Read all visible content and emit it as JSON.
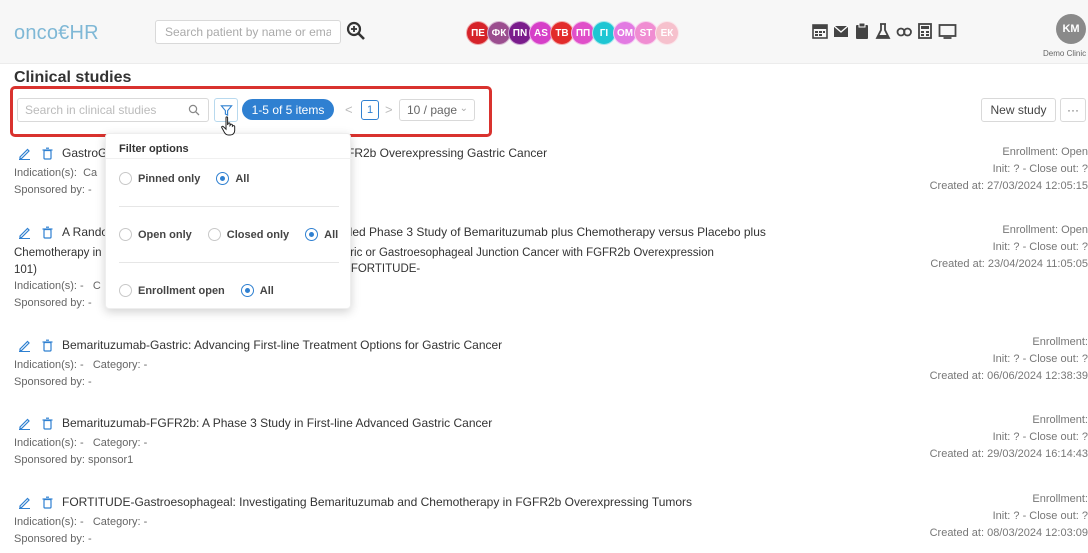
{
  "header": {
    "logo": "onco€HR",
    "search_placeholder": "Search patient by name or email",
    "avatars": [
      {
        "initials": "ПЕ",
        "color": "#d6232a"
      },
      {
        "initials": "ФК",
        "color": "#9b4e8f"
      },
      {
        "initials": "ПN",
        "color": "#7a1c8c"
      },
      {
        "initials": "AS",
        "color": "#d63fc8"
      },
      {
        "initials": "ТВ",
        "color": "#e22b2b"
      },
      {
        "initials": "ПП",
        "color": "#e04fc9"
      },
      {
        "initials": "ГІ",
        "color": "#1fc6d3"
      },
      {
        "initials": "ОМ",
        "color": "#e27ae2"
      },
      {
        "initials": "ST",
        "color": "#f08dd2"
      },
      {
        "initials": "ЕК",
        "color": "#f6c1cd"
      }
    ],
    "tool_icons": [
      "calendar-icon",
      "mail-icon",
      "clipboard-icon",
      "flask-icon",
      "microscope-icon",
      "calculator-icon",
      "monitor-icon"
    ],
    "user_initials": "KM",
    "user_org": "Demo Clinic"
  },
  "page": {
    "title": "Clinical studies",
    "search_placeholder": "Search in clinical studies",
    "items_label": "1-5 of 5 items",
    "current_page": "1",
    "page_size": "10 / page",
    "new_study_label": "New study",
    "more_label": "···",
    "accent_color": "#2f80d1",
    "highlight_color": "#d9322e"
  },
  "filter": {
    "title": "Filter options",
    "groups": [
      {
        "options": [
          {
            "label": "Pinned only",
            "selected": false
          },
          {
            "label": "All",
            "selected": true
          }
        ]
      },
      {
        "options": [
          {
            "label": "Open only",
            "selected": false
          },
          {
            "label": "Closed only",
            "selected": false
          },
          {
            "label": "All",
            "selected": true
          }
        ]
      },
      {
        "options": [
          {
            "label": "Enrollment open",
            "selected": false
          },
          {
            "label": "All",
            "selected": true
          }
        ]
      }
    ]
  },
  "studies": [
    {
      "title_visible": "GastroG",
      "title_tail": "FR2b Overexpressing Gastric Cancer",
      "indication": "Indication(s):",
      "indication_tail": "Ca",
      "sponsor": "Sponsored by: -",
      "enrollment": "Enrollment: Open",
      "init_close": "Init: ? - Close out: ?",
      "created": "Created at: 27/03/2024 12:05:15"
    },
    {
      "title_visible": "A Rando",
      "title_tail": "lled Phase 3 Study of Bemarituzumab plus Chemotherapy versus Placebo plus",
      "line2_head": "Chemotherapy in S",
      "line2_tail": "tric or Gastroesophageal Junction Cancer with FGFR2b Overexpression (FORTITUDE-",
      "line3": "101)",
      "indication": "Indication(s): -",
      "indication_tail": "C",
      "sponsor": "Sponsored by: -",
      "enrollment": "Enrollment: Open",
      "init_close": "Init: ? - Close out: ?",
      "created": "Created at: 23/04/2024 11:05:05"
    },
    {
      "title": "Bemarituzumab-Gastric: Advancing First-line Treatment Options for Gastric Cancer",
      "indication": "Indication(s): -   Category: -",
      "sponsor": "Sponsored by: -",
      "enrollment": "Enrollment:",
      "init_close": "Init: ? - Close out: ?",
      "created": "Created at: 06/06/2024 12:38:39"
    },
    {
      "title": "Bemarituzumab-FGFR2b: A Phase 3 Study in First-line Advanced Gastric Cancer",
      "indication": "Indication(s): -   Category: -",
      "sponsor": "Sponsored by: sponsor1",
      "enrollment": "Enrollment:",
      "init_close": "Init: ? - Close out: ?",
      "created": "Created at: 29/03/2024 16:14:43"
    },
    {
      "title": "FORTITUDE-Gastroesophageal: Investigating Bemarituzumab and Chemotherapy in FGFR2b Overexpressing Tumors",
      "indication": "Indication(s): -   Category: -",
      "sponsor": "Sponsored by: -",
      "enrollment": "Enrollment:",
      "init_close": "Init: ? - Close out: ?",
      "created": "Created at: 08/03/2024 12:03:09"
    }
  ]
}
